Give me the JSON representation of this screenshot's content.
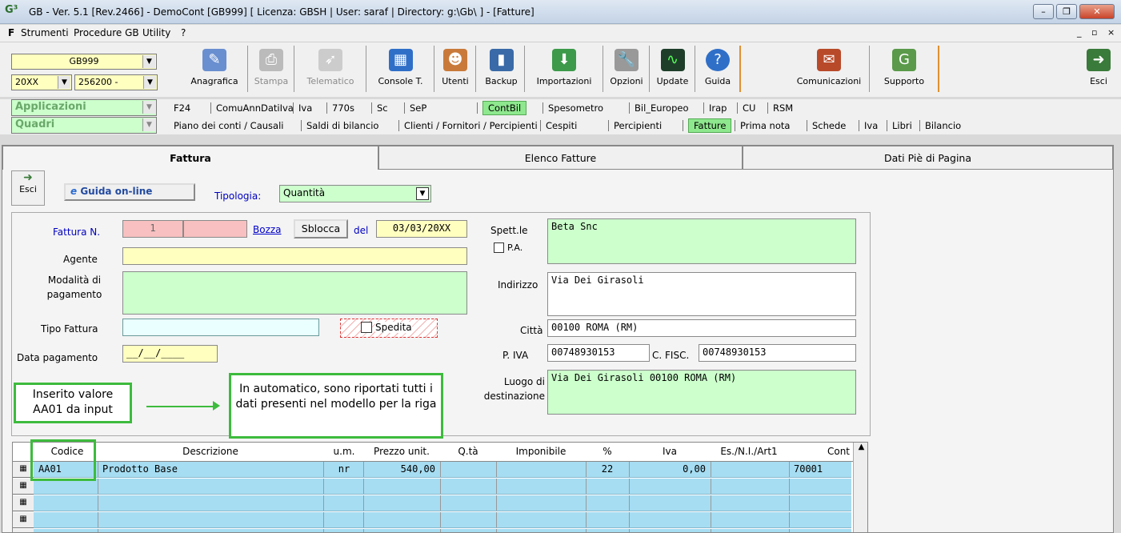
{
  "window": {
    "title": "GB - Ver. 5.1 [Rev.2466] - DemoCont [GB999]     [ Licenza: GBSH | User: saraf | Directory: g:\\Gb\\ ] - [Fatture]"
  },
  "menu": [
    "Strumenti",
    "Procedure GB",
    "Utility",
    "?"
  ],
  "toolbar": {
    "company": "GB999",
    "year": "20XX",
    "code": "256200 -",
    "buttons": [
      "Anagrafica",
      "Stampa",
      "Telematico",
      "Console T.",
      "Utenti",
      "Backup",
      "Importazioni",
      "Opzioni",
      "Update",
      "Guida"
    ],
    "right_buttons": [
      "Comunicazioni",
      "Supporto"
    ],
    "exit": "Esci"
  },
  "applicazioni": {
    "label": "Applicazioni",
    "items": [
      "F24",
      "ComuAnnDatiIva",
      "Iva",
      "770s",
      "Sc",
      "SeP",
      "ContBil",
      "Spesometro",
      "Bil_Europeo",
      "Irap",
      "CU",
      "RSM"
    ],
    "active": "ContBil"
  },
  "quadri": {
    "label": "Quadri",
    "items": [
      "Piano dei conti / Causali",
      "Saldi di bilancio",
      "Clienti / Fornitori / Percipienti",
      "Cespiti",
      "Percipienti",
      "Fatture",
      "Prima nota",
      "Schede",
      "Iva",
      "Libri",
      "Bilancio"
    ],
    "active": "Fatture"
  },
  "tabs": [
    "Fattura",
    "Elenco Fatture",
    "Dati Piè di Pagina"
  ],
  "form": {
    "exit": "Esci",
    "guide": "Guida on-line",
    "tipologia_label": "Tipologia:",
    "tipologia": "Quantità",
    "fattura_label": "Fattura N.",
    "fattura_num": "1",
    "bozza": "Bozza",
    "sblocca": "Sblocca",
    "del": "del",
    "date": "03/03/20XX",
    "agente": "Agente",
    "modalita": "Modalità di pagamento",
    "tipo_fattura": "Tipo Fattura",
    "spedita": "Spedita",
    "data_pagamento": "Data pagamento",
    "data_pagamento_value": "__/__/____",
    "spett": "Spett.le",
    "pa": "P.A.",
    "spett_value": "Beta Snc",
    "indirizzo": "Indirizzo",
    "indirizzo_value": "Via Dei Girasoli",
    "citta": "Città",
    "citta_value": "00100  ROMA (RM)",
    "piva": "P. IVA",
    "piva_value": "00748930153",
    "cfisc": "C. FISC.",
    "cfisc_value": "00748930153",
    "luogo": "Luogo di destinazione",
    "luogo_value": "Via Dei Girasoli 00100  ROMA (RM)"
  },
  "callouts": {
    "left": "Inserito valore AA01 da input",
    "right": "In automatico, sono riportati tutti i dati presenti nel modello per la riga"
  },
  "grid": {
    "headers": [
      "Codice",
      "Descrizione",
      "u.m.",
      "Prezzo unit.",
      "Q.tà",
      "Imponibile",
      "%",
      "Iva",
      "Es./N.I./Art1",
      "Cont"
    ],
    "rows": [
      {
        "codice": "AA01",
        "descrizione": "Prodotto Base",
        "um": "nr",
        "prezzo": "540,00",
        "qta": "",
        "imponibile": "",
        "perc": "22",
        "iva": "0,00",
        "es": "",
        "cont": "70001"
      }
    ]
  },
  "colors": {
    "accent": "#3dbb3d",
    "grid_row": "#a6ddf2",
    "yellow": "#ffffc0",
    "green": "#ccffcc"
  }
}
